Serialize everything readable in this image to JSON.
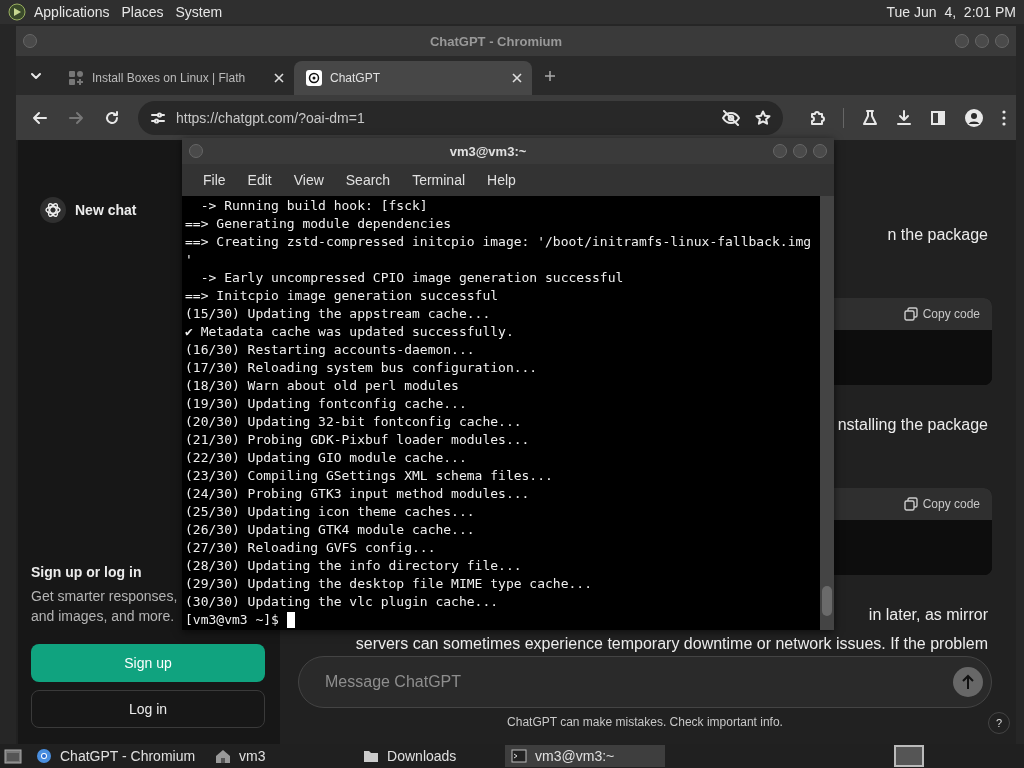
{
  "top_panel": {
    "menus": [
      "Applications",
      "Places",
      "System"
    ],
    "clock": "Tue Jun  4,  2:01 PM"
  },
  "browser": {
    "title": "ChatGPT - Chromium",
    "tabs": [
      {
        "label": "Install Boxes on Linux | Flath",
        "selected": false,
        "kind": "flathub"
      },
      {
        "label": "ChatGPT",
        "selected": true,
        "kind": "chatgpt"
      }
    ],
    "nav_buttons": [
      {
        "kind": "back",
        "disabled": false
      },
      {
        "kind": "forward",
        "disabled": true
      },
      {
        "kind": "reload",
        "disabled": false
      }
    ],
    "url": "https://chatgpt.com/?oai-dm=1"
  },
  "sidebar": {
    "new_chat": "New chat",
    "heading": "Sign up or log in",
    "lines": [
      "Get smarter responses,",
      "and images, and more."
    ],
    "buttons": [
      {
        "label": "Sign up",
        "kind": "primary"
      },
      {
        "label": "Log in",
        "kind": "secondary"
      }
    ]
  },
  "chat": {
    "blocks": [
      {
        "kind": "text",
        "lines": [
          "n the package"
        ]
      },
      {
        "kind": "code",
        "copy_label": "Copy code"
      },
      {
        "kind": "text",
        "lines": [
          "nstalling the package"
        ]
      },
      {
        "kind": "code",
        "copy_label": "Copy code"
      },
      {
        "kind": "text",
        "lines": [
          "in later, as mirror",
          "servers can sometimes experience temporary downtime or network issues. If the problem"
        ]
      }
    ],
    "composer": {
      "placeholder": "Message ChatGPT"
    },
    "disclaimer": "ChatGPT can make mistakes. Check important info.",
    "help": "?"
  },
  "terminal": {
    "title": "vm3@vm3:~",
    "menus": [
      "File",
      "Edit",
      "View",
      "Search",
      "Terminal",
      "Help"
    ],
    "lines": [
      "  -> Running build hook: [fsck]",
      "==> Generating module dependencies",
      "==> Creating zstd-compressed initcpio image: '/boot/initramfs-linux-fallback.img",
      "'",
      "  -> Early uncompressed CPIO image generation successful",
      "==> Initcpio image generation successful",
      "(15/30) Updating the appstream cache...",
      "✔ Metadata cache was updated successfully.",
      "(16/30) Restarting accounts-daemon...",
      "(17/30) Reloading system bus configuration...",
      "(18/30) Warn about old perl modules",
      "(19/30) Updating fontconfig cache...",
      "(20/30) Updating 32-bit fontconfig cache...",
      "(21/30) Probing GDK-Pixbuf loader modules...",
      "(22/30) Updating GIO module cache...",
      "(23/30) Compiling GSettings XML schema files...",
      "(24/30) Probing GTK3 input method modules...",
      "(25/30) Updating icon theme caches...",
      "(26/30) Updating GTK4 module cache...",
      "(27/30) Reloading GVFS config...",
      "(28/30) Updating the info directory file...",
      "(29/30) Updating the desktop file MIME type cache...",
      "(30/30) Updating the vlc plugin cache...",
      "[vm3@vm3 ~]$ "
    ]
  },
  "taskbar": {
    "items": [
      {
        "kind": "browser",
        "label": "ChatGPT - Chromium",
        "selected": false
      },
      {
        "kind": "home",
        "label": "vm3",
        "selected": false
      },
      {
        "kind": "folder",
        "label": "Downloads",
        "selected": false
      },
      {
        "kind": "terminal",
        "label": "vm3@vm3:~",
        "selected": true
      }
    ]
  }
}
